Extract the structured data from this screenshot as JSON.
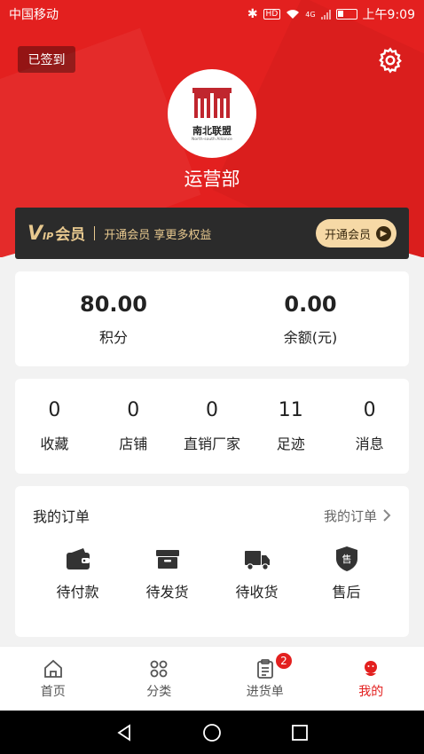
{
  "status_bar": {
    "carrier": "中国移动",
    "network_badge": "HD",
    "network_type": "4G",
    "time": "上午9:09"
  },
  "header": {
    "signed_label": "已签到",
    "logo_glyph": "",
    "logo_name": "南北联盟",
    "logo_sub": "North-south Alliance",
    "username": "运营部",
    "settings_icon": "gear-icon"
  },
  "vip": {
    "logo_v": "V",
    "logo_ip": "IP",
    "logo_cn": "会员",
    "description": "开通会员  享更多权益",
    "button_label": "开通会员",
    "colors": {
      "bg": "#2b2b2b",
      "gold": "#e8c98f"
    }
  },
  "balance": [
    {
      "value": "80.00",
      "label": "积分"
    },
    {
      "value": "0.00",
      "label": "余额(元)"
    }
  ],
  "stats": [
    {
      "value": "0",
      "label": "收藏"
    },
    {
      "value": "0",
      "label": "店铺"
    },
    {
      "value": "0",
      "label": "直销厂家"
    },
    {
      "value": "11",
      "label": "足迹"
    },
    {
      "value": "0",
      "label": "消息"
    }
  ],
  "orders": {
    "title": "我的订单",
    "more_label": "我的订单",
    "items": [
      {
        "label": "待付款",
        "icon": "wallet-icon"
      },
      {
        "label": "待发货",
        "icon": "box-icon"
      },
      {
        "label": "待收货",
        "icon": "truck-icon"
      },
      {
        "label": "售后",
        "icon": "after-sale-icon",
        "glyph": "售"
      }
    ]
  },
  "tabs": [
    {
      "label": "首页",
      "icon": "home-icon",
      "active": false
    },
    {
      "label": "分类",
      "icon": "category-icon",
      "active": false
    },
    {
      "label": "进货单",
      "icon": "clipboard-icon",
      "active": false,
      "badge": "2"
    },
    {
      "label": "我的",
      "icon": "profile-icon",
      "active": true
    }
  ],
  "colors": {
    "primary": "#e3201f",
    "background": "#f2f2f2"
  }
}
